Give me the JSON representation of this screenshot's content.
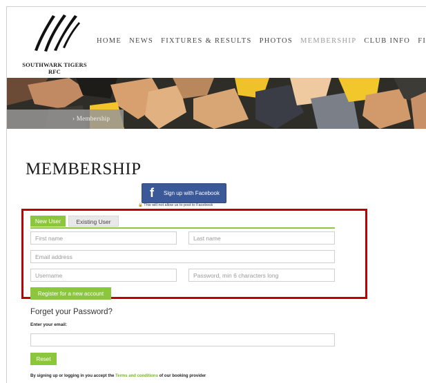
{
  "site": {
    "logo_line1": "SOUTHWARK TIGERS",
    "logo_line2": "RFC"
  },
  "nav": {
    "items": [
      "HOME",
      "NEWS",
      "FIXTURES & RESULTS",
      "PHOTOS",
      "MEMBERSHIP",
      "CLUB INFO",
      "FIND US"
    ],
    "active": "MEMBERSHIP"
  },
  "breadcrumb": {
    "text": "› Membership"
  },
  "page": {
    "title": "MEMBERSHIP"
  },
  "facebook": {
    "button_label": "Sign up with Facebook",
    "icon": "f",
    "note": "🔒 This will not allow us to post to Facebook"
  },
  "tabs": {
    "new_user": "New User",
    "existing_user": "Existing User"
  },
  "register_form": {
    "first_name_placeholder": "First name",
    "last_name_placeholder": "Last name",
    "email_placeholder": "Email address",
    "username_placeholder": "Username",
    "password_placeholder": "Password, min 6 characters long",
    "submit_label": "Register for a new account"
  },
  "forgot": {
    "heading": "Forget your Password?",
    "email_label": "Enter your email:",
    "email_value": "",
    "reset_label": "Reset"
  },
  "legal": {
    "prefix": "By signing up or logging in you accept the ",
    "link": "Terms and conditions",
    "suffix": " of our booking provider"
  },
  "colors": {
    "accent_green": "#8cc63f",
    "facebook_blue": "#3b5998",
    "highlight_red": "#c00000"
  }
}
